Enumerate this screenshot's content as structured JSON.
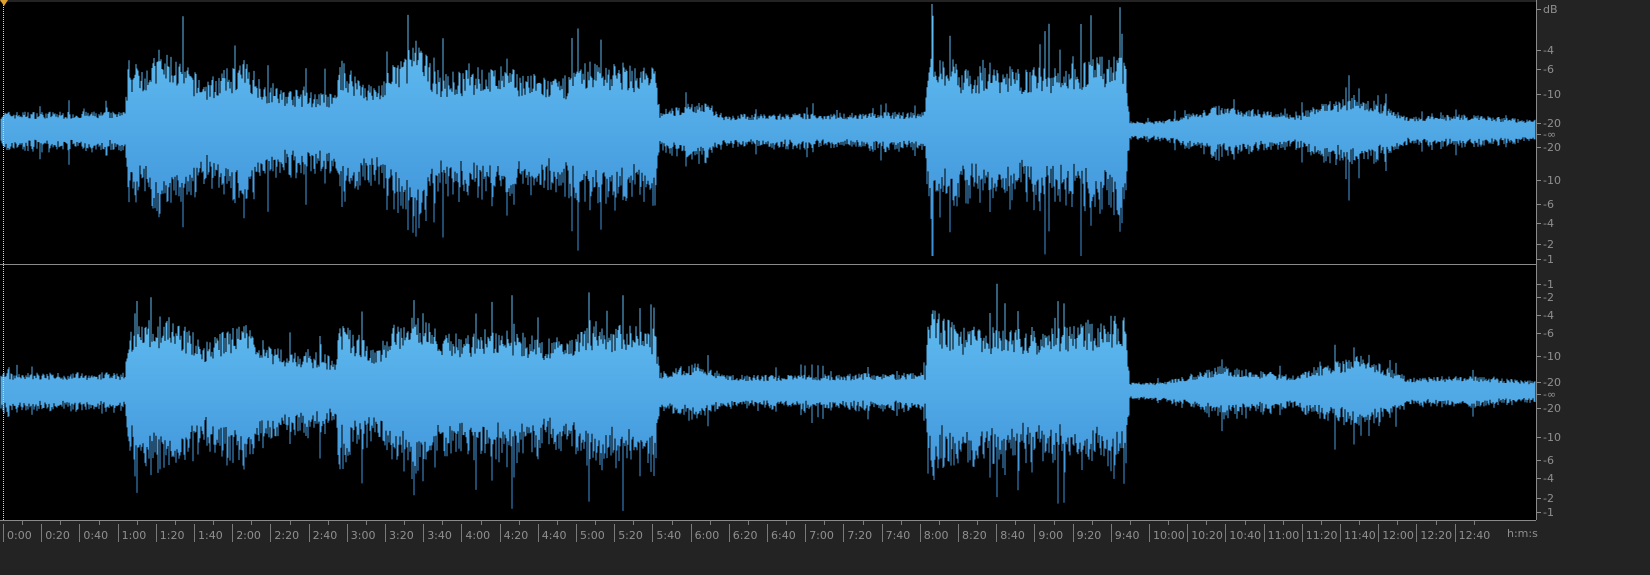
{
  "waveform": {
    "color_light": "#5cb8f0",
    "color_dark": "#3a8ed6",
    "channels": [
      "left",
      "right"
    ]
  },
  "db_ruler": {
    "unit": "dB",
    "top_labels": [
      "-4",
      "-6",
      "-10",
      "-20",
      "-∞",
      "-20",
      "-10",
      "-6",
      "-4",
      "-2",
      "-1"
    ],
    "bottom_labels": [
      "-1",
      "-2",
      "-4",
      "-6",
      "-10",
      "-20",
      "-∞",
      "-20",
      "-10",
      "-6",
      "-4",
      "-2",
      "-1"
    ]
  },
  "timeline": {
    "labels": [
      "0:00",
      "0:20",
      "0:40",
      "1:00",
      "1:20",
      "1:40",
      "2:00",
      "2:20",
      "2:40",
      "3:00",
      "3:20",
      "3:40",
      "4:00",
      "4:20",
      "4:40",
      "5:00",
      "5:20",
      "5:40",
      "6:00",
      "6:20",
      "6:40",
      "7:00",
      "7:20",
      "7:40",
      "8:00",
      "8:20",
      "8:40",
      "9:00",
      "9:20",
      "9:40",
      "10:00",
      "10:20",
      "10:40",
      "11:00",
      "11:20",
      "11:40",
      "12:00",
      "12:20",
      "12:40"
    ],
    "unit": "h:m:s"
  }
}
